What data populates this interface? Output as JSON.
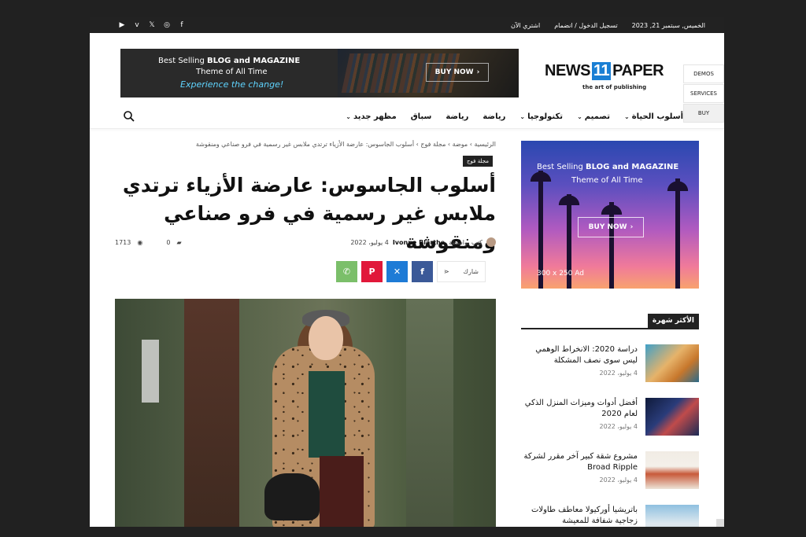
{
  "topbar": {
    "date": "الخميس, سبتمبر 21, 2023",
    "login": "تسجيل الدخول / انضمام",
    "buy_now": "اشتري الآن",
    "social_icons": [
      "youtube-icon",
      "vimeo-icon",
      "x-icon",
      "instagram-icon",
      "facebook-icon"
    ]
  },
  "header_ad": {
    "line1_prefix": "Best Selling ",
    "line1_bold": "BLOG and MAGAZINE",
    "line2": "Theme of All Time",
    "line3": "Experience the change!",
    "button": "BUY NOW"
  },
  "logo": {
    "word_left": "NEWS",
    "number": "11",
    "word_right": "PAPER",
    "tagline": "the art of publishing"
  },
  "demo_panel": {
    "items": [
      "DEMOS",
      "SERVICES",
      "BUY"
    ]
  },
  "nav": {
    "items": [
      {
        "label": "أسلوب الحياة",
        "has_dropdown": true
      },
      {
        "label": "تصميم",
        "has_dropdown": true
      },
      {
        "label": "تكنولوجيا",
        "has_dropdown": true
      },
      {
        "label": "رياضة",
        "has_dropdown": false
      },
      {
        "label": "رياضة",
        "has_dropdown": false
      },
      {
        "label": "سباق",
        "has_dropdown": false
      },
      {
        "label": "مظهر جديد",
        "has_dropdown": true
      }
    ]
  },
  "article": {
    "breadcrumb": "الرئيسية › موضة › مجلة فوج › أسلوب الجاسوس: عارضة الأزياء ترتدي ملابس غير رسمية في فرو صناعي ومنقوشة",
    "category": "مجلة فوج",
    "title": "أسلوب الجاسوس: عارضة الأزياء ترتدي ملابس غير رسمية في فرو صناعي ومنقوشة",
    "by_label": "كتب بواسطة",
    "author": "Ivonne Blarthe",
    "date": "4 يوليو، 2022",
    "views": "1713",
    "comments": "0",
    "share_label": "شارك"
  },
  "sidebar": {
    "ad": {
      "line1_prefix": "Best Selling ",
      "line1_bold": "BLOG and MAGAZINE",
      "line2": "Theme of All Time",
      "button": "BUY NOW",
      "size": "300 x 250 Ad"
    },
    "popular_heading": "الأكثر شهرة",
    "popular": [
      {
        "title": "دراسة 2020: الانخراط الوهمي ليس سوى نصف المشكلة",
        "date": "4 يوليو، 2022"
      },
      {
        "title": "أفضل أدوات وميزات المنزل الذكي لعام 2020",
        "date": "4 يوليو، 2022"
      },
      {
        "title": "مشروع شقة كبير آخر مقرر لشركة Broad Ripple",
        "date": "4 يوليو، 2022"
      },
      {
        "title": "باتريشيا أوركيولا معاطف طاولات زجاجية شفافة للمعيشة",
        "date": ""
      }
    ]
  }
}
